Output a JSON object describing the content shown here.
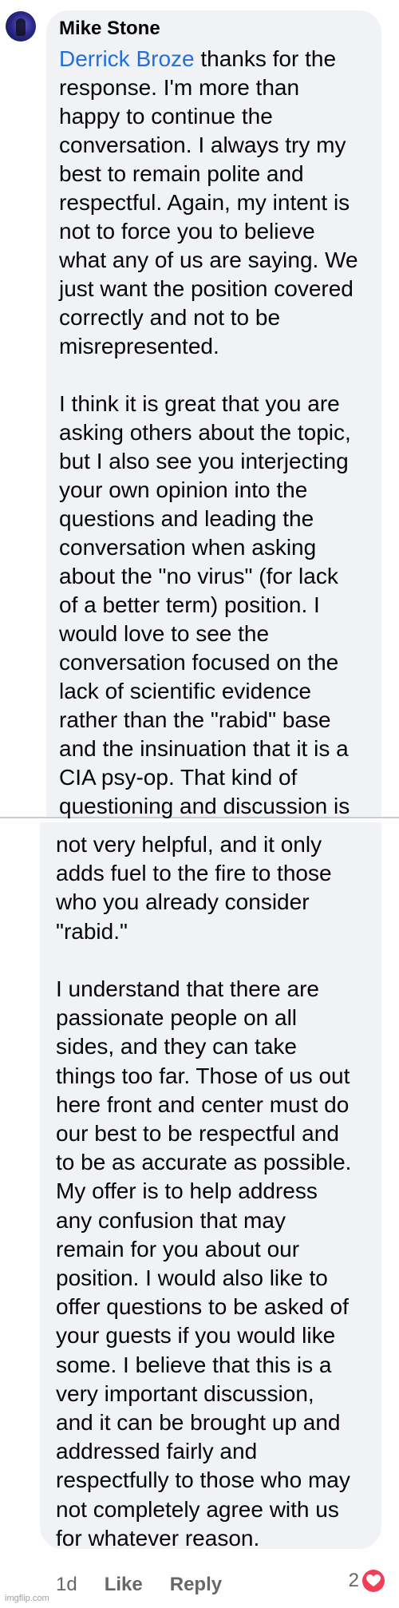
{
  "comment": {
    "author": "Mike Stone",
    "mention": "Derrick Broze",
    "text_part1": " thanks for the\nresponse. I'm more than\nhappy to continue the\nconversation. I always try my\nbest to remain polite and\nrespectful. Again, my intent is\nnot to force you to believe\nwhat any of us are saying. We\njust want the position covered\ncorrectly and not to be\nmisrepresented.\n\nI think it is great that you are\nasking others about the topic,\nbut I also see you interjecting\nyour own opinion into the\nquestions and leading the\nconversation when asking\nabout the \"no virus\" (for lack\nof a better term) position. I\nwould love to see the\nconversation focused on the\nlack of scientific evidence\nrather than the \"rabid\" base\nand the insinuation that it is a\nCIA psy-op. That kind of\nquestioning and discussion is",
    "text_part2": "not very helpful, and it only\nadds fuel to the fire to those\nwho you already consider\n\"rabid.\"\n\nI understand that there are\npassionate people on all\nsides, and they can take\nthings too far. Those of us out\nhere front and center must do\nour best to be respectful and\nto be as accurate as possible.\nMy offer is to help address\nany confusion that may\nremain for you about our\nposition. I would also like to\noffer questions to be asked of\nyour guests if you would like\nsome. I believe that this is a\nvery important discussion,\nand it can be brought up and\naddressed fairly and\nrespectfully to those who may\nnot completely agree with us\nfor whatever reason."
  },
  "actions": {
    "time": "1d",
    "like": "Like",
    "reply": "Reply",
    "reaction_count": "2",
    "reaction_icon": "heart-icon"
  },
  "watermark": "imgflip.com",
  "colors": {
    "bubble": "#f0f2f5",
    "mention": "#216fdb",
    "meta": "#65676b",
    "heart": "#f33e58"
  }
}
